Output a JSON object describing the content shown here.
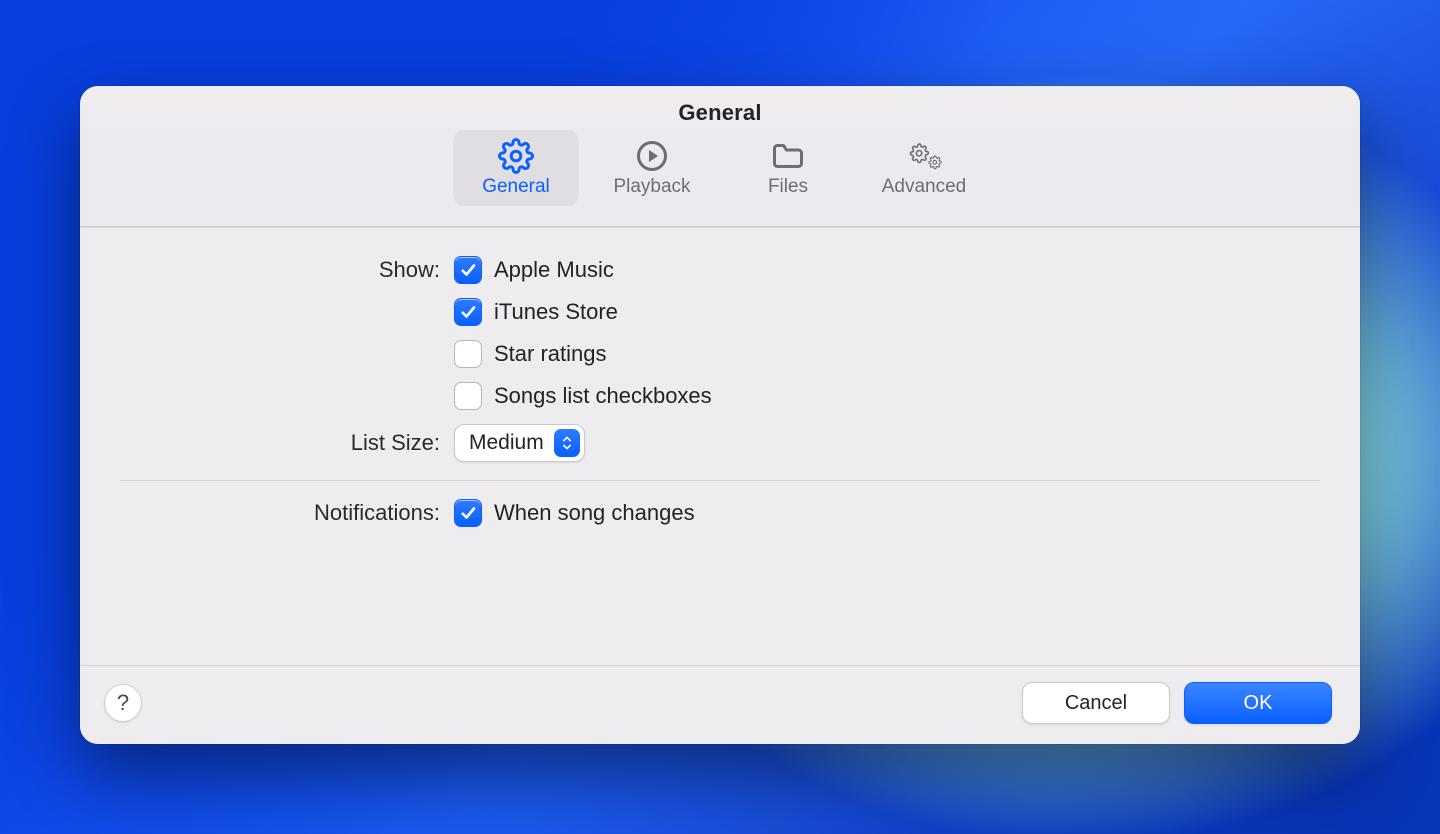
{
  "window": {
    "title": "General"
  },
  "tabs": [
    {
      "label": "General",
      "icon": "gear-icon"
    },
    {
      "label": "Playback",
      "icon": "play-circle-icon"
    },
    {
      "label": "Files",
      "icon": "folder-icon"
    },
    {
      "label": "Advanced",
      "icon": "gears-icon"
    }
  ],
  "labels": {
    "show": "Show:",
    "list_size": "List Size:",
    "notifications": "Notifications:"
  },
  "show": {
    "apple_music": {
      "label": "Apple Music",
      "checked": true
    },
    "itunes_store": {
      "label": "iTunes Store",
      "checked": true
    },
    "star_ratings": {
      "label": "Star ratings",
      "checked": false
    },
    "songs_list": {
      "label": "Songs list checkboxes",
      "checked": false
    }
  },
  "list_size": {
    "value": "Medium"
  },
  "notifications": {
    "when_song_changes": {
      "label": "When song changes",
      "checked": true
    }
  },
  "footer": {
    "help": "?",
    "cancel": "Cancel",
    "ok": "OK"
  }
}
